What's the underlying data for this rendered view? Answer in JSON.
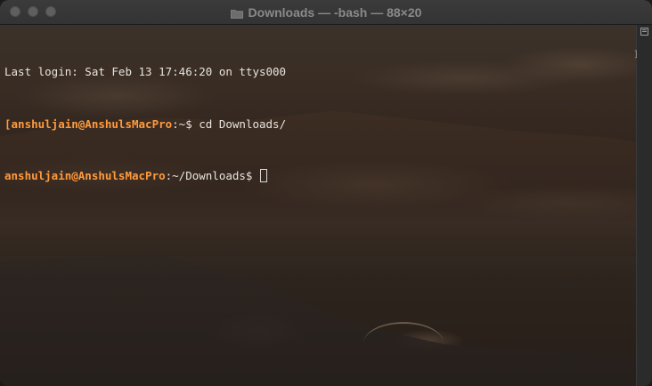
{
  "window": {
    "title": "Downloads — -bash — 88×20",
    "title_icon": "folder-icon"
  },
  "terminal": {
    "last_login": "Last login: Sat Feb 13 17:46:20 on ttys000",
    "line2_user": "[anshuljain@AnshulsMacPro",
    "line2_rest": ":~$ cd Downloads/",
    "line3_user": "anshuljain@AnshulsMacPro",
    "line3_rest": ":~/Downloads$ "
  },
  "colors": {
    "prompt_user": "#ff9a3d",
    "text": "#e8e4df",
    "titlebar": "#363636"
  }
}
